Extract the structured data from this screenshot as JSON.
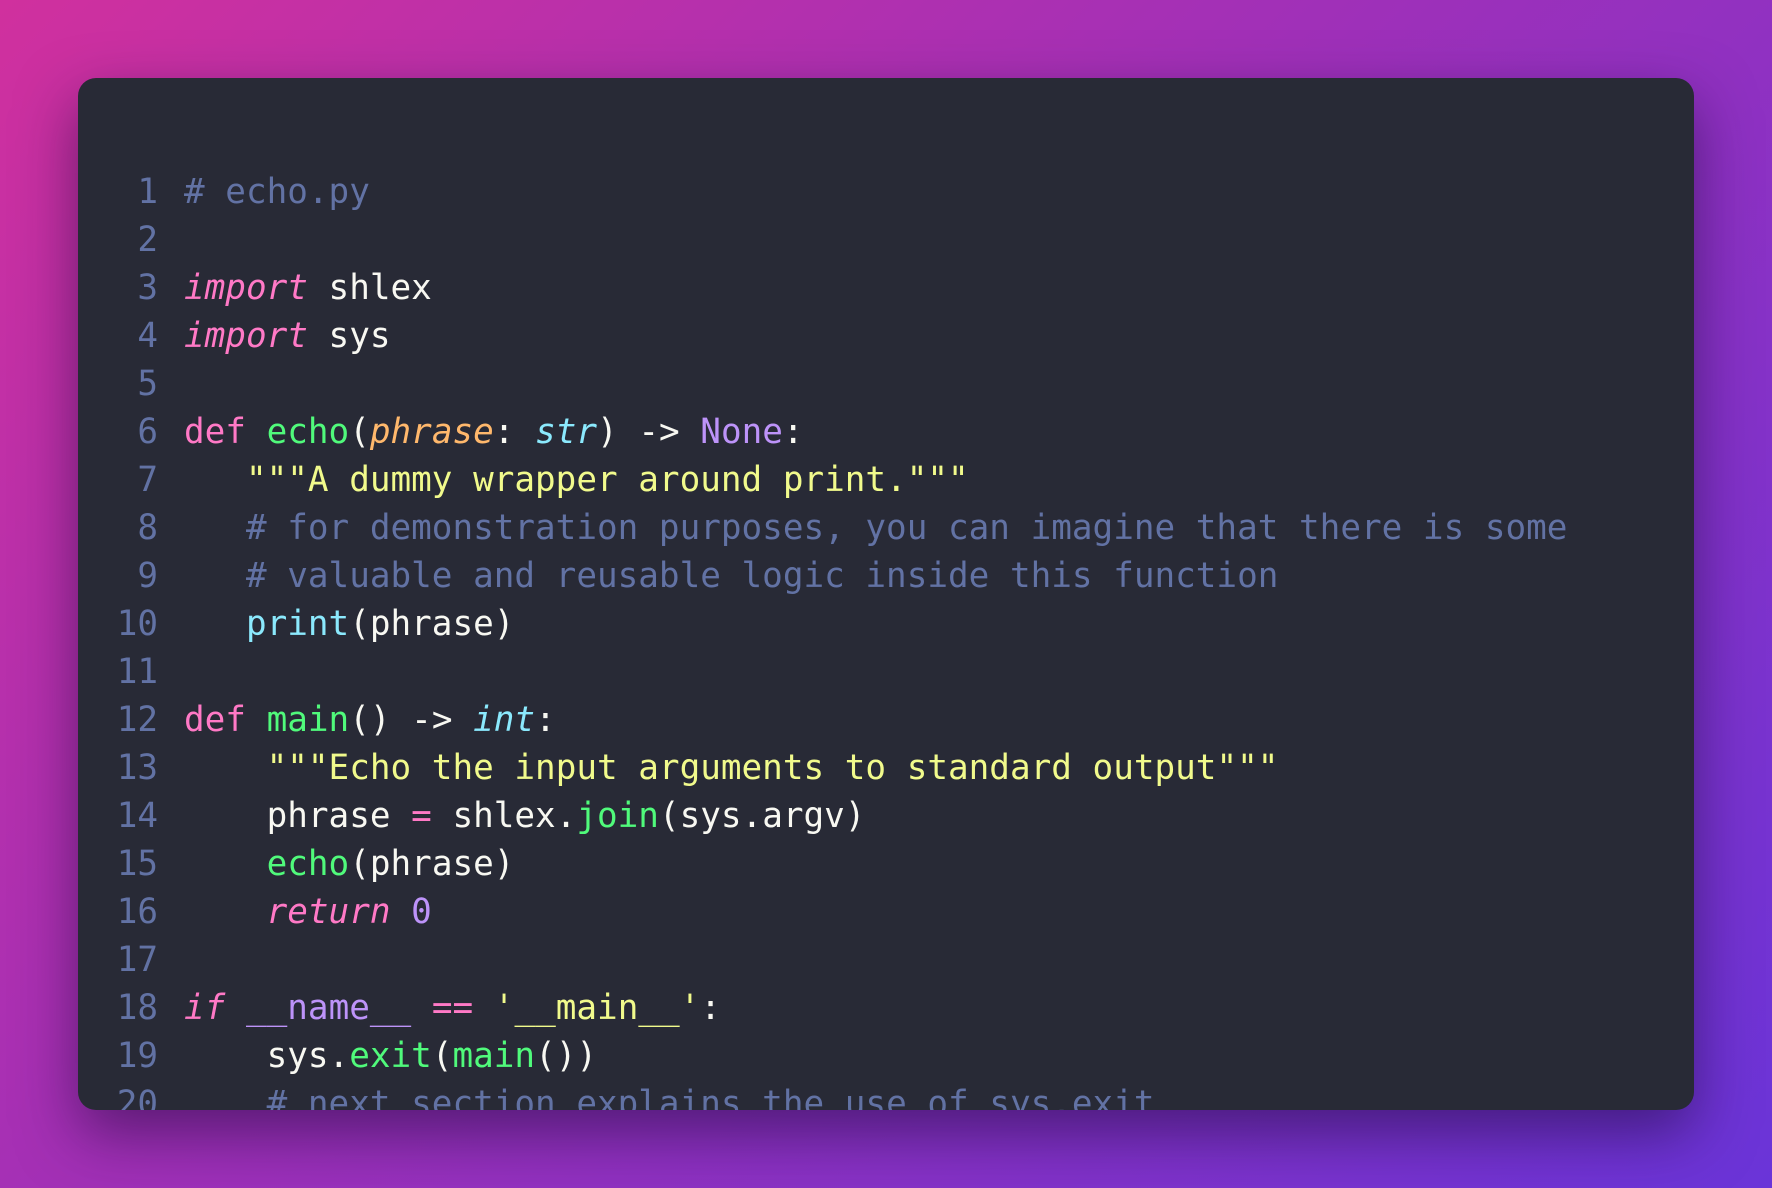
{
  "editor": {
    "file_label": "# echo.py",
    "colors": {
      "background": "#282a36",
      "default": "#f8f8f2",
      "comment": "#6272a4",
      "keyword": "#ff79c6",
      "function": "#50fa7b",
      "parameter": "#ffb86c",
      "builtin": "#8be9fd",
      "constant": "#bd93f9",
      "string": "#f1fa8c",
      "line_number": "#6272a4"
    },
    "lines": [
      {
        "number": "1",
        "indent": 0,
        "tokens": [
          {
            "text": "# echo.py",
            "type": "comment"
          }
        ]
      },
      {
        "number": "2",
        "indent": 0,
        "tokens": []
      },
      {
        "number": "3",
        "indent": 0,
        "tokens": [
          {
            "text": "import",
            "type": "keyword-italic"
          },
          {
            "text": " shlex",
            "type": "default"
          }
        ]
      },
      {
        "number": "4",
        "indent": 0,
        "tokens": [
          {
            "text": "import",
            "type": "keyword-italic"
          },
          {
            "text": " sys",
            "type": "default"
          }
        ]
      },
      {
        "number": "5",
        "indent": 0,
        "tokens": []
      },
      {
        "number": "6",
        "indent": 0,
        "tokens": [
          {
            "text": "def",
            "type": "keyword"
          },
          {
            "text": " ",
            "type": "default"
          },
          {
            "text": "echo",
            "type": "function"
          },
          {
            "text": "(",
            "type": "default"
          },
          {
            "text": "phrase",
            "type": "parameter"
          },
          {
            "text": ": ",
            "type": "default"
          },
          {
            "text": "str",
            "type": "builtin-italic"
          },
          {
            "text": ") -> ",
            "type": "default"
          },
          {
            "text": "None",
            "type": "constant"
          },
          {
            "text": ":",
            "type": "default"
          }
        ]
      },
      {
        "number": "7",
        "indent": 3,
        "tokens": [
          {
            "text": "\"\"\"A dummy wrapper around print.\"\"\"",
            "type": "string"
          }
        ]
      },
      {
        "number": "8",
        "indent": 3,
        "tokens": [
          {
            "text": "# for demonstration purposes, you can imagine that there is some",
            "type": "comment"
          }
        ]
      },
      {
        "number": "9",
        "indent": 3,
        "tokens": [
          {
            "text": "# valuable and reusable logic inside this function",
            "type": "comment"
          }
        ]
      },
      {
        "number": "10",
        "indent": 3,
        "tokens": [
          {
            "text": "print",
            "type": "builtin"
          },
          {
            "text": "(phrase)",
            "type": "default"
          }
        ]
      },
      {
        "number": "11",
        "indent": 0,
        "tokens": []
      },
      {
        "number": "12",
        "indent": 0,
        "tokens": [
          {
            "text": "def",
            "type": "keyword"
          },
          {
            "text": " ",
            "type": "default"
          },
          {
            "text": "main",
            "type": "function"
          },
          {
            "text": "() -> ",
            "type": "default"
          },
          {
            "text": "int",
            "type": "builtin-italic"
          },
          {
            "text": ":",
            "type": "default"
          }
        ]
      },
      {
        "number": "13",
        "indent": 4,
        "tokens": [
          {
            "text": "\"\"\"Echo the input arguments to standard output\"\"\"",
            "type": "string"
          }
        ]
      },
      {
        "number": "14",
        "indent": 4,
        "tokens": [
          {
            "text": "phrase ",
            "type": "default"
          },
          {
            "text": "=",
            "type": "keyword"
          },
          {
            "text": " shlex.",
            "type": "default"
          },
          {
            "text": "join",
            "type": "function"
          },
          {
            "text": "(sys.argv)",
            "type": "default"
          }
        ]
      },
      {
        "number": "15",
        "indent": 4,
        "tokens": [
          {
            "text": "echo",
            "type": "function"
          },
          {
            "text": "(phrase)",
            "type": "default"
          }
        ]
      },
      {
        "number": "16",
        "indent": 4,
        "tokens": [
          {
            "text": "return",
            "type": "keyword-italic"
          },
          {
            "text": " ",
            "type": "default"
          },
          {
            "text": "0",
            "type": "constant"
          }
        ]
      },
      {
        "number": "17",
        "indent": 0,
        "tokens": []
      },
      {
        "number": "18",
        "indent": 0,
        "tokens": [
          {
            "text": "if",
            "type": "keyword-italic"
          },
          {
            "text": " ",
            "type": "default"
          },
          {
            "text": "__name__",
            "type": "constant"
          },
          {
            "text": " ",
            "type": "default"
          },
          {
            "text": "==",
            "type": "keyword"
          },
          {
            "text": " ",
            "type": "default"
          },
          {
            "text": "'__main__'",
            "type": "string"
          },
          {
            "text": ":",
            "type": "default"
          }
        ]
      },
      {
        "number": "19",
        "indent": 4,
        "tokens": [
          {
            "text": "sys.",
            "type": "default"
          },
          {
            "text": "exit",
            "type": "function"
          },
          {
            "text": "(",
            "type": "default"
          },
          {
            "text": "main",
            "type": "function"
          },
          {
            "text": "())",
            "type": "default"
          }
        ]
      },
      {
        "number": "20",
        "indent": 4,
        "tokens": [
          {
            "text": "# next section explains the use of sys.exit",
            "type": "comment"
          }
        ]
      }
    ]
  }
}
